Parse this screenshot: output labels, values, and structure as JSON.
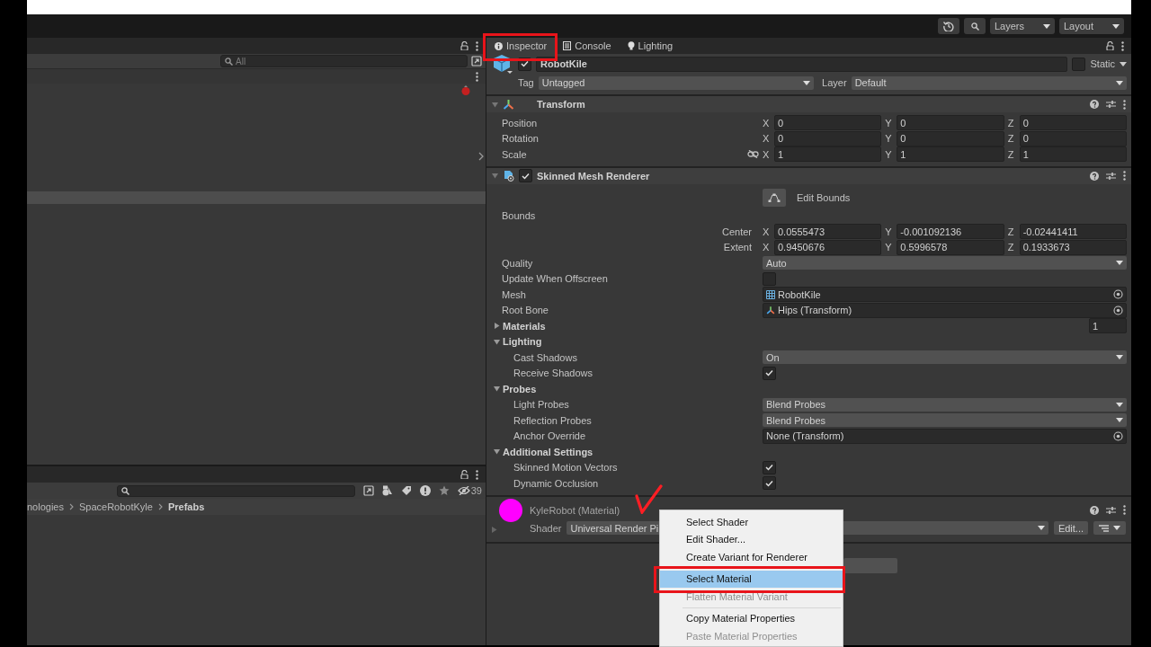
{
  "toolbar": {
    "dropdowns": [
      "Layers",
      "Layout"
    ]
  },
  "hierarchy_panel": {
    "search": {
      "placeholder": "All"
    }
  },
  "project_panel": {
    "hidden_count": "39",
    "breadcrumb": [
      {
        "label": "nologies",
        "current": false
      },
      {
        "label": "SpaceRobotKyle",
        "current": false
      },
      {
        "label": "Prefabs",
        "current": true
      }
    ]
  },
  "inspector": {
    "tabs": [
      {
        "label": "Inspector",
        "kind": "info",
        "selected": true,
        "annotated": true
      },
      {
        "label": "Console",
        "kind": "console",
        "selected": false,
        "annotated": false
      },
      {
        "label": "Lighting",
        "kind": "bulb",
        "selected": false,
        "annotated": false
      }
    ],
    "object": {
      "active": true,
      "name": "RobotKile",
      "static": false,
      "static_label": "Static",
      "tag_label": "Tag",
      "tag": "Untagged",
      "layer_label": "Layer",
      "layer": "Default"
    },
    "components": [
      {
        "title": "Transform",
        "kind": "transform",
        "rows": [
          {
            "kind": "vector3",
            "label": "Position",
            "values": [
              {
                "axis": "X",
                "value": "0"
              },
              {
                "axis": "Y",
                "value": "0"
              },
              {
                "axis": "Z",
                "value": "0"
              }
            ]
          },
          {
            "kind": "vector3",
            "label": "Rotation",
            "values": [
              {
                "axis": "X",
                "value": "0"
              },
              {
                "axis": "Y",
                "value": "0"
              },
              {
                "axis": "Z",
                "value": "0"
              }
            ]
          },
          {
            "kind": "vector3",
            "label": "Scale",
            "proportional": false,
            "values": [
              {
                "axis": "X",
                "value": "1"
              },
              {
                "axis": "Y",
                "value": "1"
              },
              {
                "axis": "Z",
                "value": "1"
              }
            ]
          }
        ]
      },
      {
        "title": "Skinned Mesh Renderer",
        "kind": "renderer",
        "enabled": true,
        "rows": [
          {
            "kind": "button",
            "label": "Edit Bounds"
          },
          {
            "kind": "heading",
            "label": "Bounds"
          },
          {
            "kind": "vector3_sub",
            "label": "Center",
            "values": [
              {
                "axis": "X",
                "value": "0.0555473"
              },
              {
                "axis": "Y",
                "value": "-0.001092136"
              },
              {
                "axis": "Z",
                "value": "-0.02441411"
              }
            ]
          },
          {
            "kind": "vector3_sub",
            "label": "Extent",
            "values": [
              {
                "axis": "X",
                "value": "0.9450676"
              },
              {
                "axis": "Y",
                "value": "0.5996578"
              },
              {
                "axis": "Z",
                "value": "0.1933673"
              }
            ]
          },
          {
            "kind": "dropdown",
            "label": "Quality",
            "value": "Auto"
          },
          {
            "kind": "checkbox",
            "label": "Update When Offscreen",
            "checked": false
          },
          {
            "kind": "mesh",
            "label": "Mesh",
            "value": "RobotKile"
          },
          {
            "kind": "bone",
            "label": "Root Bone",
            "value": "Hips (Transform)"
          },
          {
            "kind": "foldout",
            "label": "Materials",
            "expanded": false,
            "count": "1"
          },
          {
            "kind": "foldout",
            "label": "Lighting",
            "expanded": true,
            "children": [
              {
                "kind": "dropdown",
                "label": "Cast Shadows",
                "value": "On"
              },
              {
                "kind": "checkbox",
                "label": "Receive Shadows",
                "checked": true
              }
            ]
          },
          {
            "kind": "foldout",
            "label": "Probes",
            "expanded": true,
            "children": [
              {
                "kind": "dropdown",
                "label": "Light Probes",
                "value": "Blend Probes"
              },
              {
                "kind": "dropdown",
                "label": "Reflection Probes",
                "value": "Blend Probes"
              },
              {
                "kind": "object",
                "label": "Anchor Override",
                "value": "None (Transform)"
              }
            ]
          },
          {
            "kind": "foldout",
            "label": "Additional Settings",
            "expanded": true,
            "children": [
              {
                "kind": "checkbox",
                "label": "Skinned Motion Vectors",
                "checked": true
              },
              {
                "kind": "checkbox",
                "label": "Dynamic Occlusion",
                "checked": true
              }
            ]
          }
        ]
      }
    ],
    "material": {
      "name": "KyleRobot (Material)",
      "color": "#ff00ff",
      "shader_label": "Shader",
      "shader": "Universal Render Pi",
      "edit_button": "Edit...",
      "annotated": true
    }
  },
  "context_menu": {
    "items": [
      {
        "kind": "item",
        "label": "Select Shader",
        "disabled": false,
        "selected": false,
        "annotated": false
      },
      {
        "kind": "item",
        "label": "Edit Shader...",
        "disabled": false,
        "selected": false,
        "annotated": false
      },
      {
        "kind": "item",
        "label": "Create Variant for Renderer",
        "disabled": false,
        "selected": false,
        "annotated": false
      },
      {
        "kind": "separator"
      },
      {
        "kind": "item",
        "label": "Select Material",
        "disabled": false,
        "selected": true,
        "annotated": true
      },
      {
        "kind": "item",
        "label": "Flatten Material Variant",
        "disabled": true,
        "selected": false,
        "annotated": false
      },
      {
        "kind": "separator"
      },
      {
        "kind": "item",
        "label": "Copy Material Properties",
        "disabled": false,
        "selected": false,
        "annotated": false
      },
      {
        "kind": "item",
        "label": "Paste Material Properties",
        "disabled": true,
        "selected": false,
        "annotated": false
      }
    ]
  }
}
